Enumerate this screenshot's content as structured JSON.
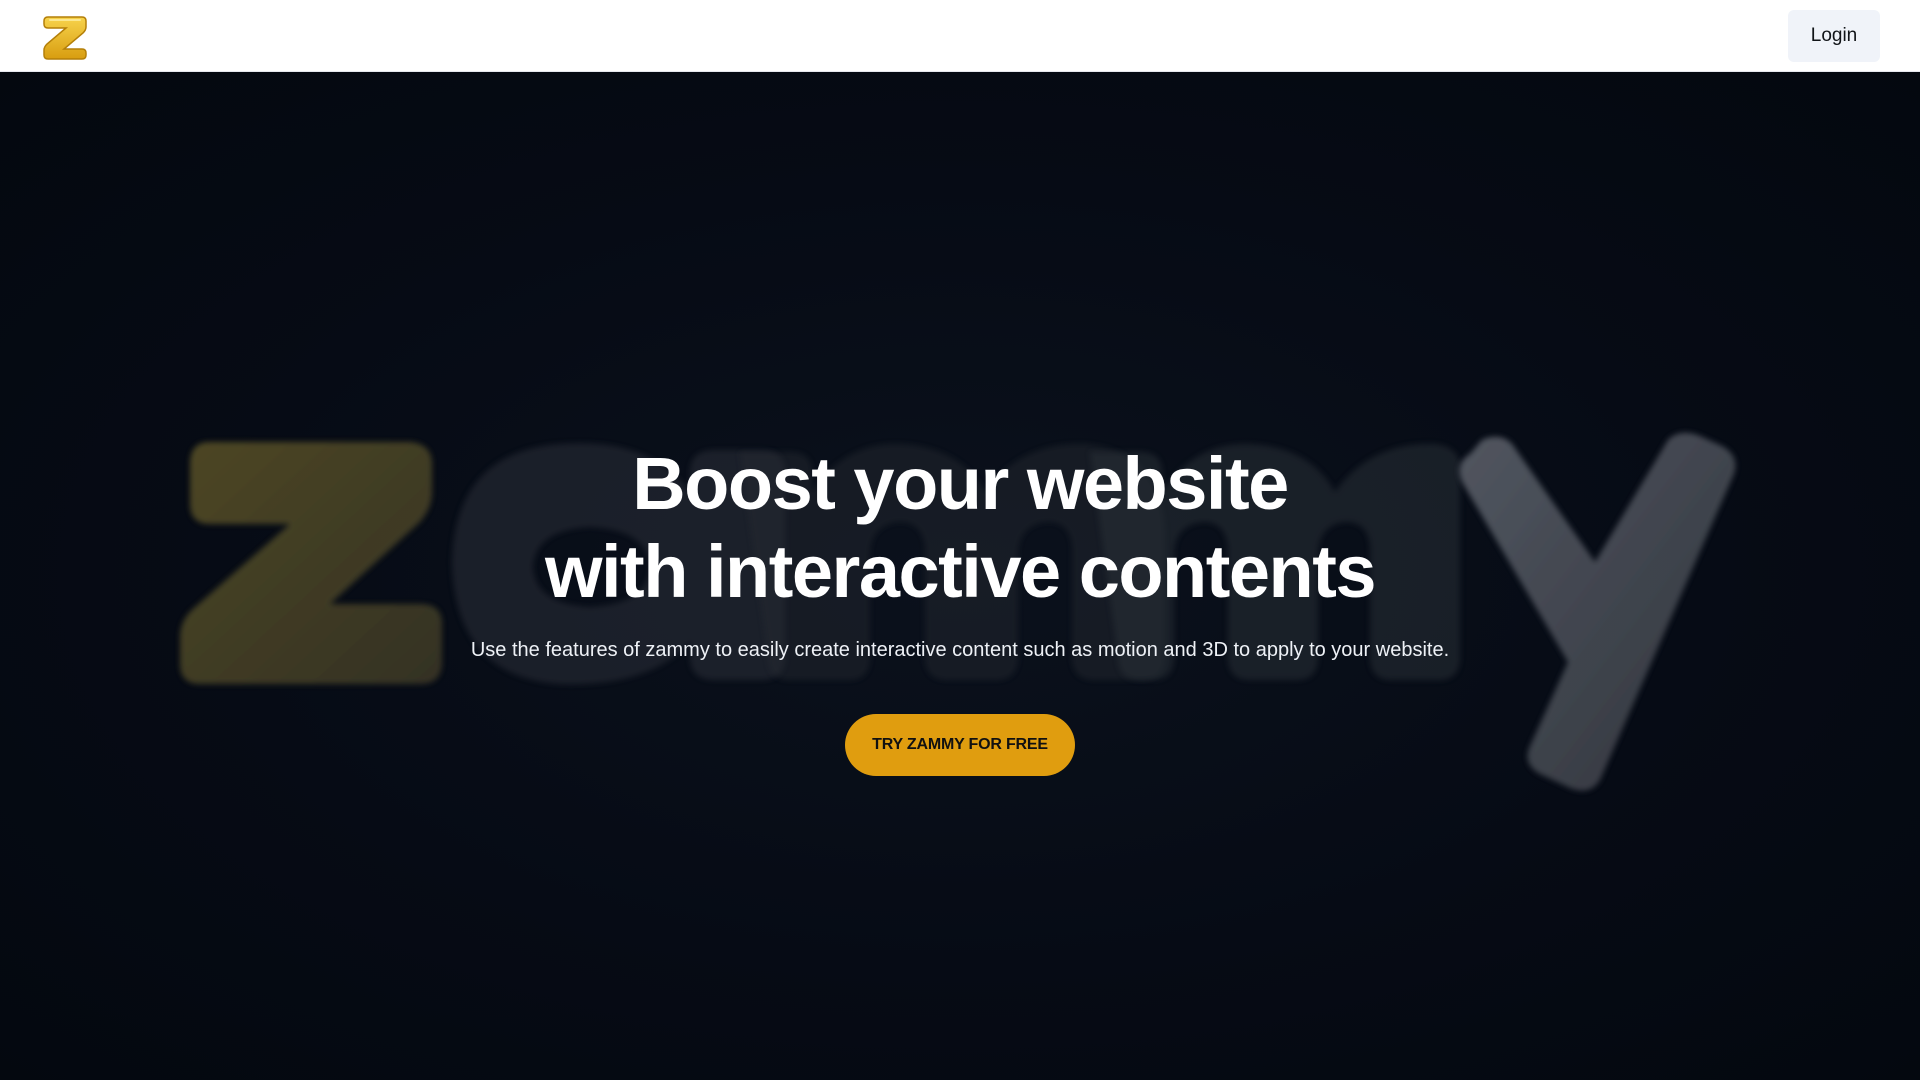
{
  "header": {
    "logo_letter": "Z",
    "login_label": "Login"
  },
  "hero": {
    "background_word": "zammy",
    "headline_line1": "Boost your website",
    "headline_line2": "with interactive contents",
    "subtitle": "Use the features of zammy to easily create interactive content such as motion and 3D to apply to your website.",
    "cta_label": "TRY ZAMMY FOR FREE"
  },
  "colors": {
    "accent": "#e09d0f",
    "background": "#050a14",
    "header_bg": "#ffffff",
    "login_bg": "#f0f3f9"
  }
}
